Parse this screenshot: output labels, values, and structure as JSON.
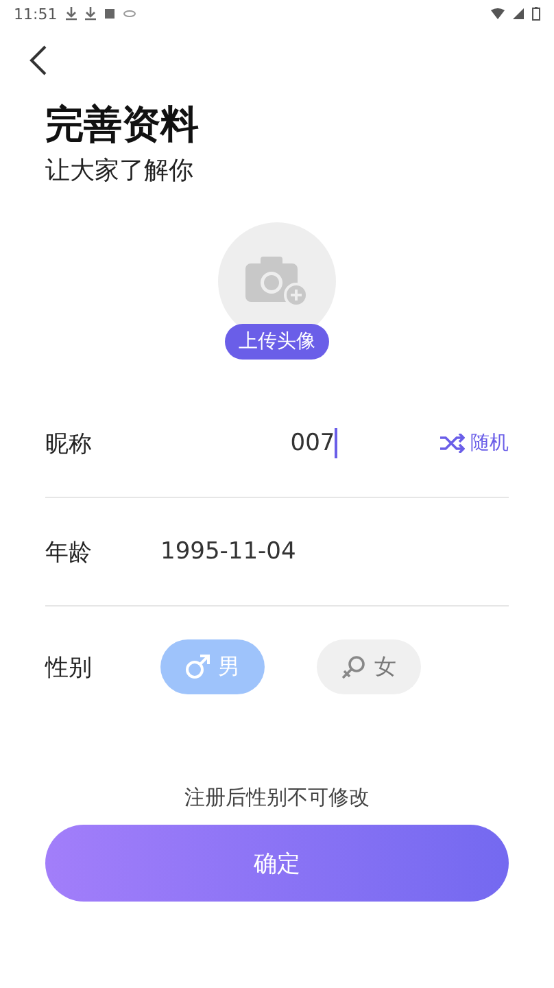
{
  "status_bar": {
    "time": "11:51"
  },
  "header": {
    "title": "完善资料",
    "subtitle": "让大家了解你"
  },
  "avatar": {
    "upload_label": "上传头像"
  },
  "fields": [
    {
      "kind": "nickname",
      "label": "昵称",
      "value": "007",
      "action": "随机"
    },
    {
      "kind": "date",
      "label": "年龄",
      "value": "1995-11-04"
    }
  ],
  "gender": {
    "label": "性别",
    "options": [
      {
        "kind": "male",
        "label": "男",
        "selected": true
      },
      {
        "kind": "female",
        "label": "女",
        "selected": false
      }
    ]
  },
  "note": "注册后性别不可修改",
  "confirm_button": "确定"
}
